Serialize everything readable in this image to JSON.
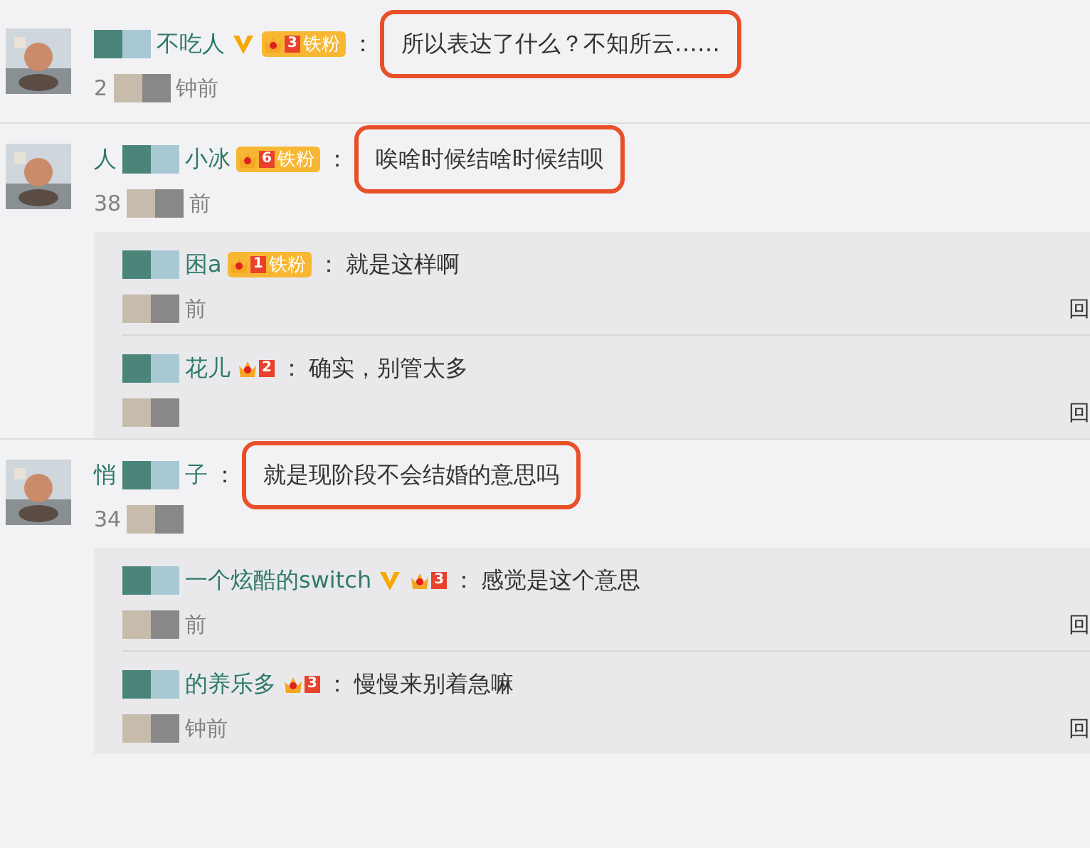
{
  "comments": [
    {
      "name_end": "不吃人",
      "verified": true,
      "badge": {
        "level": "3",
        "label": "铁粉"
      },
      "colon": "：",
      "text": "所以表达了什么？不知所云……",
      "highlighted": true,
      "time_start": "2",
      "time_end": "钟前"
    },
    {
      "name_start": "人",
      "name_end": "小冰",
      "verified": false,
      "badge": {
        "level": "6",
        "label": "铁粉"
      },
      "colon": "：",
      "text": "唉啥时候结啥时候结呗",
      "highlighted": true,
      "time_start": "38",
      "time_end": "前",
      "replies": [
        {
          "name_end": "困a",
          "verified": false,
          "badge": {
            "level": "1",
            "label": "铁粉"
          },
          "colon": "：",
          "text": "就是这样啊",
          "time_end": "前",
          "reply": "回"
        },
        {
          "name_end": "花儿",
          "verified": false,
          "badge": {
            "level": "2"
          },
          "colon": "：",
          "text": "确实，别管太多",
          "reply": "回"
        }
      ]
    },
    {
      "name_start": "悄",
      "name_end": "子",
      "verified": false,
      "colon": "：",
      "text": "就是现阶段不会结婚的意思吗",
      "highlighted": true,
      "time_start": "34",
      "replies": [
        {
          "name_end": "一个炫酷的switch",
          "verified": true,
          "badge": {
            "level": "3"
          },
          "colon": "：",
          "text": "感觉是这个意思",
          "time_end": "前",
          "reply": "回"
        },
        {
          "name_end": "的养乐多",
          "verified": false,
          "badge": {
            "level": "3"
          },
          "colon": "：",
          "text": "慢慢来别着急嘛",
          "time_end": "钟前",
          "reply": "回"
        }
      ]
    }
  ]
}
